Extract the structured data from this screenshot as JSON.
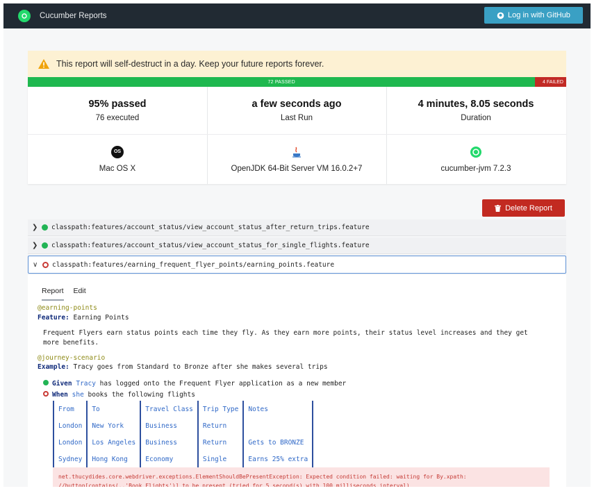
{
  "topbar": {
    "title": "Cucumber Reports",
    "login_label": "Log in with GitHub"
  },
  "warning": {
    "text": "This report will self-destruct in a day. Keep your future reports forever."
  },
  "progress": {
    "passed_label": "72 PASSED",
    "failed_label": "4 FAILED",
    "passed": 72,
    "failed": 4
  },
  "stats": {
    "passed": {
      "value": "95% passed",
      "sub": "76 executed"
    },
    "last_run": {
      "value": "a few seconds ago",
      "sub": "Last Run"
    },
    "duration": {
      "value": "4 minutes, 8.05 seconds",
      "sub": "Duration"
    },
    "os": {
      "icon": "os-icon",
      "label": "Mac OS X",
      "badge": "OS"
    },
    "jvm": {
      "icon": "java-icon",
      "label": "OpenJDK 64-Bit Server VM 16.0.2+7"
    },
    "runner": {
      "icon": "cucumber-icon",
      "label": "cucumber-jvm 7.2.3"
    }
  },
  "delete_label": "Delete Report",
  "features": [
    {
      "path": "classpath:features/account_status/view_account_status_after_return_trips.feature",
      "status": "passed"
    },
    {
      "path": "classpath:features/account_status/view_account_status_for_single_flights.feature",
      "status": "passed"
    },
    {
      "path": "classpath:features/earning_frequent_flyer_points/earning_points.feature",
      "status": "failed"
    }
  ],
  "report": {
    "tabs": [
      "Report",
      "Edit"
    ],
    "feature_tag": "@earning-points",
    "feature_kw": "Feature:",
    "feature_name": " Earning Points",
    "description": "Frequent Flyers earn status points each time they fly. As they earn more points, their status level increases and they get more benefits.",
    "scenario_tag": "@journey-scenario",
    "example_kw": "Example:",
    "example_name": " Tracy goes from Standard to Bronze after she makes several trips",
    "step1": {
      "kw": "Given",
      "actor": "Tracy",
      "text": " has logged onto the Frequent Flyer application as a new member"
    },
    "step2": {
      "kw": "When",
      "actor": "she",
      "text": " books the following flights"
    },
    "table": [
      [
        "From",
        "To",
        "Travel Class",
        "Trip Type",
        "Notes"
      ],
      [
        "London",
        "New York",
        "Business",
        "Return",
        ""
      ],
      [
        "London",
        "Los Angeles",
        "Business",
        "Return",
        "Gets to BRONZE"
      ],
      [
        "Sydney",
        "Hong Kong",
        "Economy",
        "Single",
        "Earns 25% extra"
      ]
    ],
    "error": "net.thucydides.core.webdriver.exceptions.ElementShouldBePresentException: Expected condition failed: waiting for By.xpath: //button[contains(.,'Book Flights')] to be present (tried for 5 second(s) with 100 milliseconds interval)"
  }
}
